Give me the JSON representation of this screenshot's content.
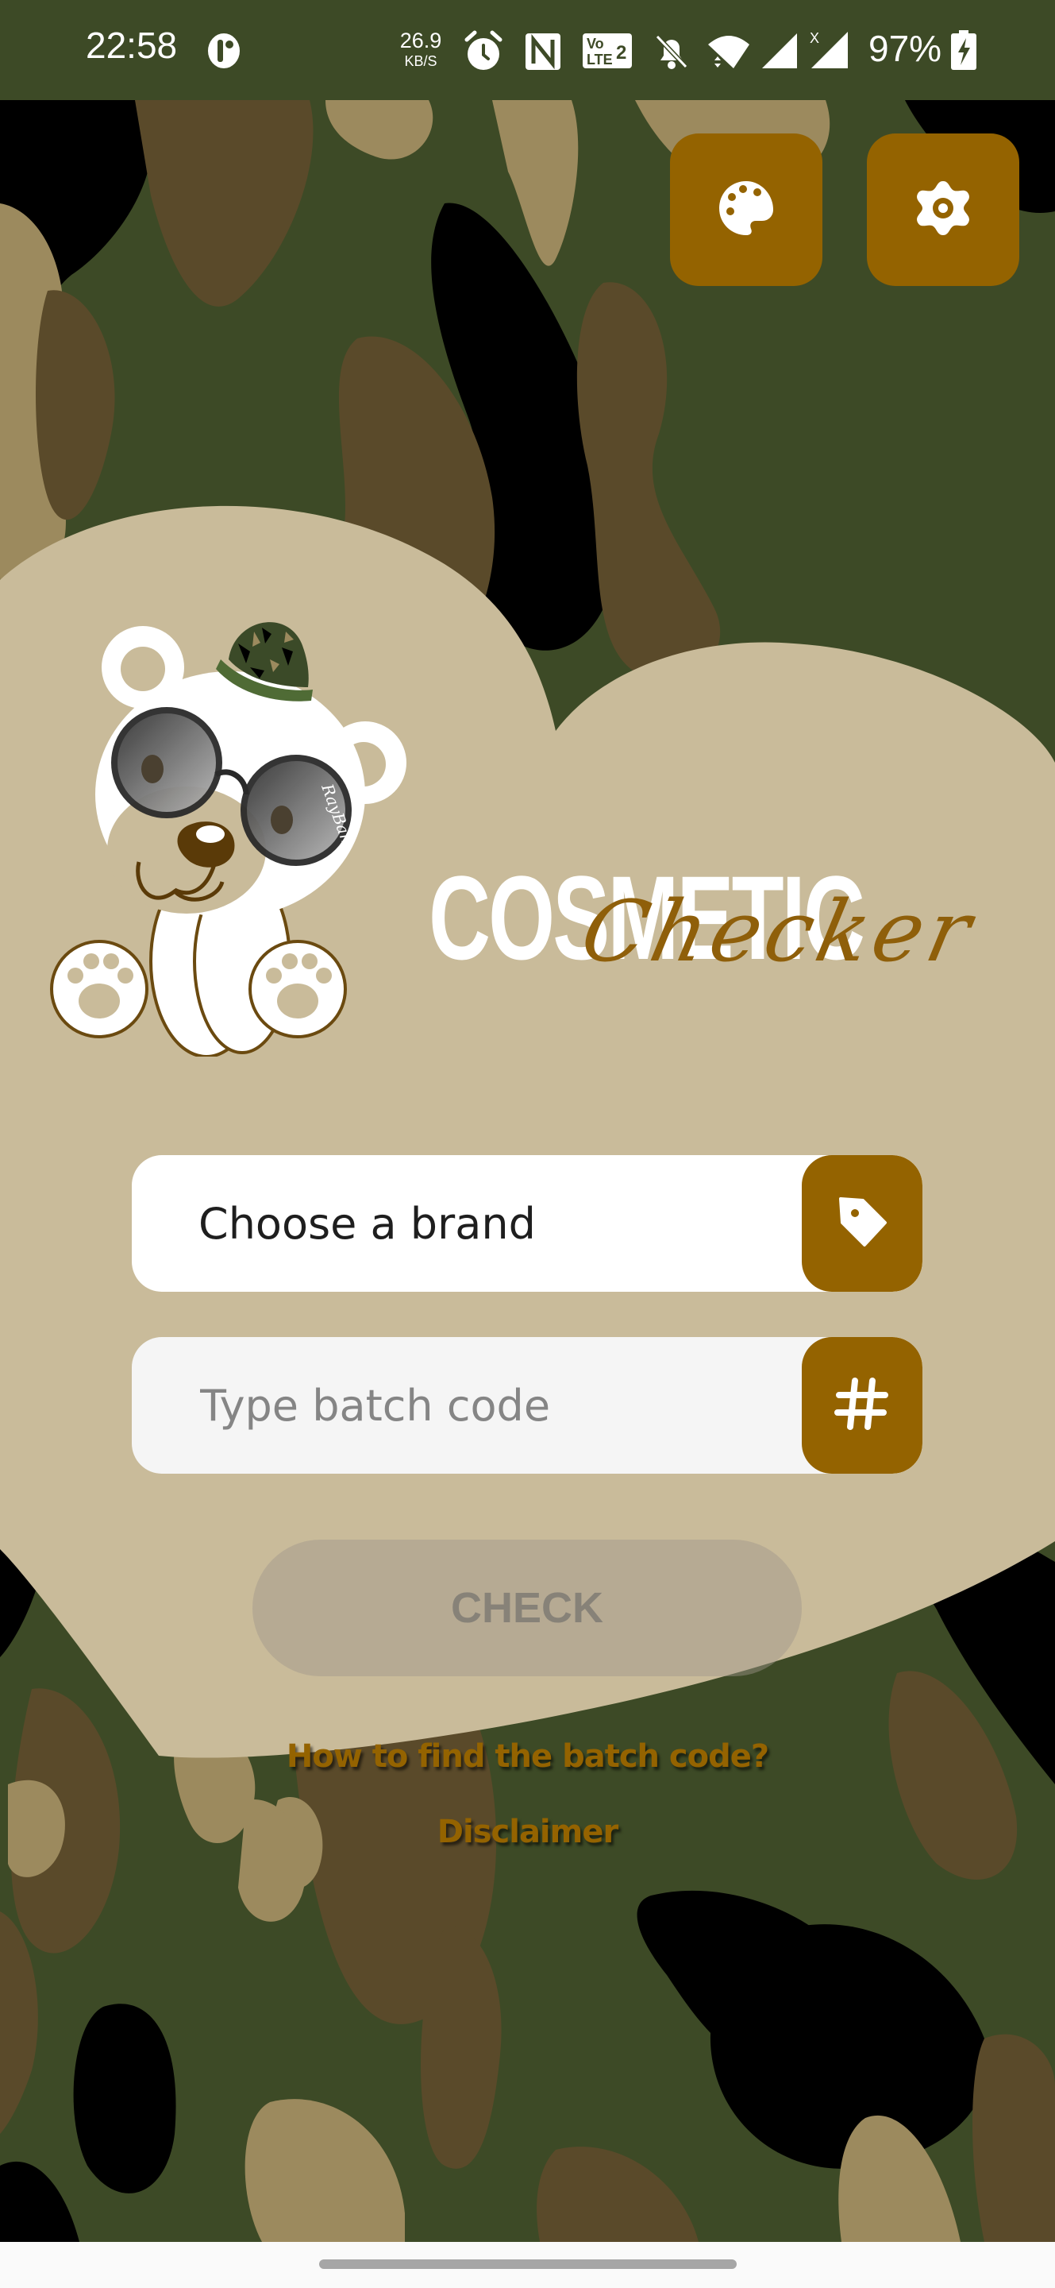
{
  "status_bar": {
    "time": "22:58",
    "net_speed_value": "26.9",
    "net_speed_unit": "KB/S",
    "battery_percent": "97%",
    "icons": [
      "app-notification-icon",
      "alarm-icon",
      "nfc-icon",
      "volte-2-icon",
      "notifications-off-icon",
      "wifi-icon",
      "signal-icon",
      "signal-no-data-icon",
      "battery-charging-icon"
    ]
  },
  "toolbar": {
    "theme_button_icon": "palette-icon",
    "settings_button_icon": "settings-icon"
  },
  "logo": {
    "title_main": "COSMETIC",
    "title_script": "Checker",
    "mascot": "bear-with-sunglasses-and-camo-hat",
    "glasses_brand": "RayBan"
  },
  "form": {
    "brand_label": "Choose a brand",
    "brand_icon": "tag-icon",
    "batch_placeholder": "Type batch code",
    "batch_value": "",
    "batch_icon": "#",
    "check_label": "CHECK",
    "check_enabled": false
  },
  "links": {
    "how_to": "How to find the batch code?",
    "disclaimer": "Disclaimer"
  },
  "colors": {
    "accent": "#946300",
    "status_bar": "#3d4a26",
    "heart": "#c9bb9a",
    "camo_green": "#3d4a26",
    "camo_brown": "#5a4a2a",
    "camo_tan": "#9c8a5e",
    "camo_black": "#000000"
  }
}
